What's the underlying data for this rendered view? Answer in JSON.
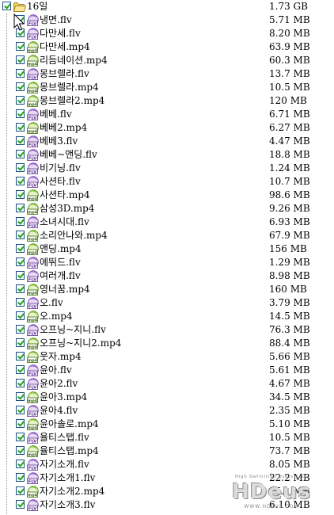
{
  "folder": {
    "name": "16일",
    "size": "1.73 GB",
    "icon": "folder-open-icon"
  },
  "files": [
    {
      "name": "냉면.flv",
      "size": "5.71 MB",
      "type": "flv"
    },
    {
      "name": "다만세.flv",
      "size": "8.20 MB",
      "type": "flv"
    },
    {
      "name": "다만세.mp4",
      "size": "63.9 MB",
      "type": "mp4"
    },
    {
      "name": "리듬네이션.mp4",
      "size": "60.3 MB",
      "type": "mp4"
    },
    {
      "name": "몽브렐라.flv",
      "size": "13.7 MB",
      "type": "flv"
    },
    {
      "name": "몽브렐라.mp4",
      "size": "10.5 MB",
      "type": "mp4"
    },
    {
      "name": "몽브렐라2.mp4",
      "size": "120 MB",
      "type": "mp4"
    },
    {
      "name": "베베.flv",
      "size": "6.71 MB",
      "type": "flv"
    },
    {
      "name": "베베2.mp4",
      "size": "6.27 MB",
      "type": "mp4"
    },
    {
      "name": "베베3.flv",
      "size": "4.47 MB",
      "type": "flv"
    },
    {
      "name": "베베~앤딩.flv",
      "size": "18.8 MB",
      "type": "flv"
    },
    {
      "name": "비기닝.flv",
      "size": "1.24 MB",
      "type": "flv"
    },
    {
      "name": "사션타.flv",
      "size": "10.7 MB",
      "type": "flv"
    },
    {
      "name": "사션타.mp4",
      "size": "98.6 MB",
      "type": "mp4"
    },
    {
      "name": "삼성3D.mp4",
      "size": "9.26 MB",
      "type": "mp4"
    },
    {
      "name": "소녀시대.flv",
      "size": "6.93 MB",
      "type": "flv"
    },
    {
      "name": "소리안나와.mp4",
      "size": "67.9 MB",
      "type": "mp4"
    },
    {
      "name": "앤딩.mp4",
      "size": "156 MB",
      "type": "mp4"
    },
    {
      "name": "에뛰드.flv",
      "size": "1.29 MB",
      "type": "flv"
    },
    {
      "name": "여러개.flv",
      "size": "8.98 MB",
      "type": "flv"
    },
    {
      "name": "영너꿈.mp4",
      "size": "160 MB",
      "type": "mp4"
    },
    {
      "name": "오.flv",
      "size": "3.79 MB",
      "type": "flv"
    },
    {
      "name": "오.mp4",
      "size": "14.5 MB",
      "type": "mp4"
    },
    {
      "name": "오프닝~지니.flv",
      "size": "76.3 MB",
      "type": "flv"
    },
    {
      "name": "오프닝~지니2.mp4",
      "size": "88.4 MB",
      "type": "mp4"
    },
    {
      "name": "웃자.mp4",
      "size": "5.66 MB",
      "type": "mp4"
    },
    {
      "name": "윤아.flv",
      "size": "5.61 MB",
      "type": "flv"
    },
    {
      "name": "윤아2.flv",
      "size": "4.67 MB",
      "type": "flv"
    },
    {
      "name": "윤아3.mp4",
      "size": "34.5 MB",
      "type": "mp4"
    },
    {
      "name": "윤아4.flv",
      "size": "2.35 MB",
      "type": "flv"
    },
    {
      "name": "윤아솔로.mp4",
      "size": "5.10 MB",
      "type": "mp4"
    },
    {
      "name": "율티스탭.flv",
      "size": "10.5 MB",
      "type": "flv"
    },
    {
      "name": "율티스탭.mp4",
      "size": "73.7 MB",
      "type": "mp4"
    },
    {
      "name": "자기소개.flv",
      "size": "8.05 MB",
      "type": "flv"
    },
    {
      "name": "자기소개1.flv",
      "size": "22.2 MB",
      "type": "flv"
    },
    {
      "name": "자기소개2.mp4",
      "size": "15.1 MB",
      "type": "mp4"
    },
    {
      "name": "자기소개3.flv",
      "size": "6.10 MB",
      "type": "flv"
    }
  ],
  "watermark": {
    "sub": "High Definition Users Club",
    "main": "HDeus",
    "url": "WWW.HDEUS.COM"
  }
}
